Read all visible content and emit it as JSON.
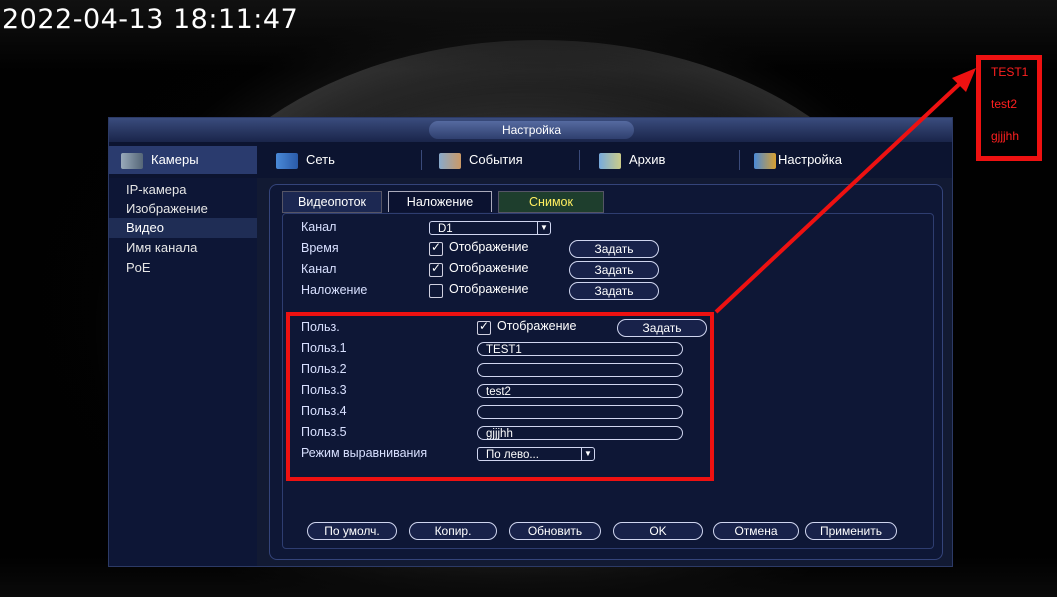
{
  "timestamp": "2022-04-13 18:11:47",
  "overlay_preview": [
    "TEST1",
    "test2",
    "gjjjhh"
  ],
  "window": {
    "title": "Настройка",
    "nav": [
      {
        "label": "Камеры",
        "icon": "camera-icon"
      },
      {
        "label": "Сеть",
        "icon": "network-icon"
      },
      {
        "label": "События",
        "icon": "events-icon"
      },
      {
        "label": "Архив",
        "icon": "archive-icon"
      },
      {
        "label": "Настройка",
        "icon": "settings-icon"
      }
    ],
    "sidebar": [
      "IP-камера",
      "Изображение",
      "Видео",
      "Имя канала",
      "PoE"
    ],
    "tabs": [
      "Видеопоток",
      "Наложение",
      "Снимок"
    ],
    "form": {
      "channel_label": "Канал",
      "channel_value": "D1",
      "rows": [
        {
          "label": "Время",
          "checked": true,
          "chk_label": "Отображение",
          "btn": "Задать"
        },
        {
          "label": "Канал",
          "checked": true,
          "chk_label": "Отображение",
          "btn": "Задать"
        },
        {
          "label": "Наложение",
          "checked": false,
          "chk_label": "Отображение",
          "btn": "Задать"
        }
      ],
      "user": {
        "label": "Польз.",
        "chk_label": "Отображение",
        "btn": "Задать",
        "fields": [
          {
            "label": "Польз.1",
            "value": "TEST1"
          },
          {
            "label": "Польз.2",
            "value": ""
          },
          {
            "label": "Польз.3",
            "value": "test2"
          },
          {
            "label": "Польз.4",
            "value": ""
          },
          {
            "label": "Польз.5",
            "value": "gjjjhh"
          }
        ],
        "align_label": "Режим выравнивания",
        "align_value": "По лево..."
      }
    },
    "buttons": [
      "По умолч.",
      "Копир.",
      "Обновить",
      "OK",
      "Отмена",
      "Применить"
    ]
  }
}
